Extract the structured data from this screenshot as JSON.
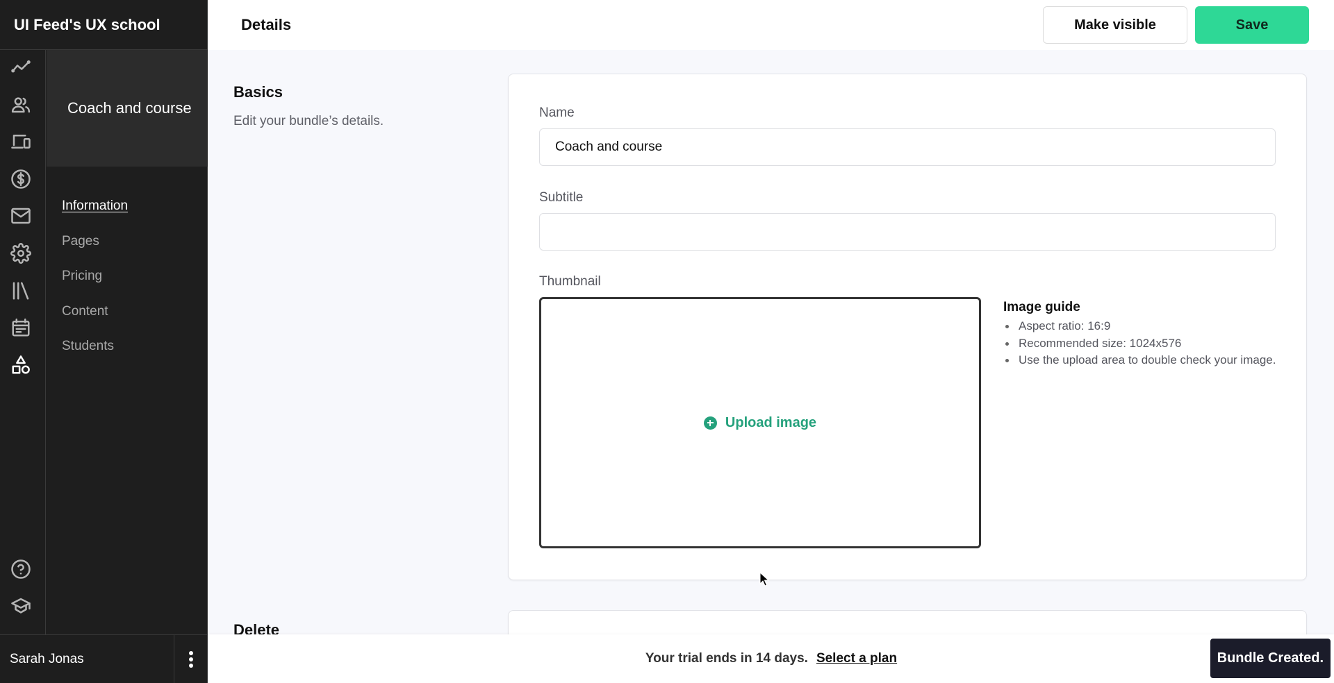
{
  "app": {
    "brand": "UI Feed's UX school"
  },
  "rail": {
    "icons": [
      {
        "name": "analytics-icon",
        "label": "Analytics"
      },
      {
        "name": "users-icon",
        "label": "Users"
      },
      {
        "name": "devices-icon",
        "label": "Devices"
      },
      {
        "name": "dollar-icon",
        "label": "Sales"
      },
      {
        "name": "mail-icon",
        "label": "Emails"
      },
      {
        "name": "gear-icon",
        "label": "Settings"
      },
      {
        "name": "library-icon",
        "label": "Library"
      },
      {
        "name": "calendar-icon",
        "label": "Calendar"
      },
      {
        "name": "shapes-icon",
        "label": "Products",
        "active": true
      }
    ],
    "bottom_icons": [
      {
        "name": "help-icon",
        "label": "Help"
      },
      {
        "name": "graduation-cap-icon",
        "label": "Academy"
      }
    ]
  },
  "subnav": {
    "title": "Coach and course",
    "items": [
      {
        "label": "Information",
        "active": true
      },
      {
        "label": "Pages"
      },
      {
        "label": "Pricing"
      },
      {
        "label": "Content"
      },
      {
        "label": "Students"
      }
    ]
  },
  "user": {
    "name": "Sarah Jonas",
    "menu_icon": "more-vertical-icon"
  },
  "header": {
    "title": "Details",
    "make_visible_label": "Make visible",
    "save_label": "Save",
    "accent_color": "#2ed896"
  },
  "basics": {
    "title": "Basics",
    "description": "Edit your bundle’s details.",
    "name_label": "Name",
    "name_value": "Coach and course",
    "subtitle_label": "Subtitle",
    "subtitle_value": "",
    "thumbnail_label": "Thumbnail",
    "upload_label": "Upload image",
    "upload_icon": "plus-circle-icon",
    "image_guide": {
      "title": "Image guide",
      "items": [
        "Aspect ratio: 16:9",
        "Recommended size: 1024x576",
        "Use the upload area to double check your image."
      ]
    }
  },
  "delete": {
    "title": "Delete"
  },
  "trial": {
    "message": "Your trial ends in 14 days.",
    "link_label": "Select a plan"
  },
  "toast": {
    "message": "Bundle Created."
  }
}
